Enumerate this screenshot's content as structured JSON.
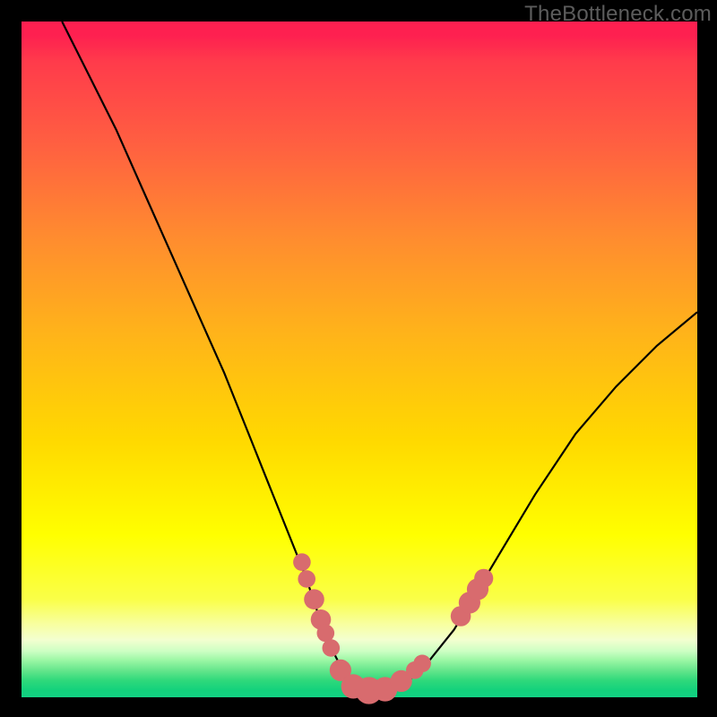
{
  "watermark": "TheBottleneck.com",
  "chart_data": {
    "type": "line",
    "title": "",
    "xlabel": "",
    "ylabel": "",
    "xlim": [
      0,
      100
    ],
    "ylim": [
      0,
      100
    ],
    "series": [
      {
        "name": "curve",
        "x": [
          6,
          10,
          14,
          18,
          22,
          26,
          30,
          34,
          36,
          38,
          40,
          42,
          44,
          45,
          46,
          47,
          48,
          49,
          50,
          51,
          52,
          53,
          54,
          56,
          58,
          60,
          64,
          70,
          76,
          82,
          88,
          94,
          100
        ],
        "y": [
          100,
          92,
          84,
          75,
          66,
          57,
          48,
          38,
          33,
          28,
          23,
          18,
          12,
          9,
          7,
          5,
          3,
          2,
          1,
          1,
          1,
          1,
          1,
          2,
          3,
          5,
          10,
          20,
          30,
          39,
          46,
          52,
          57
        ]
      }
    ],
    "markers": [
      {
        "x": 41.5,
        "y": 20,
        "r": 1.3
      },
      {
        "x": 42.2,
        "y": 17.5,
        "r": 1.3
      },
      {
        "x": 43.3,
        "y": 14.5,
        "r": 1.5
      },
      {
        "x": 44.3,
        "y": 11.5,
        "r": 1.5
      },
      {
        "x": 45.0,
        "y": 9.5,
        "r": 1.3
      },
      {
        "x": 45.8,
        "y": 7.3,
        "r": 1.3
      },
      {
        "x": 47.2,
        "y": 4.0,
        "r": 1.6
      },
      {
        "x": 49.1,
        "y": 1.6,
        "r": 1.8
      },
      {
        "x": 51.4,
        "y": 1.0,
        "r": 2.0
      },
      {
        "x": 53.8,
        "y": 1.2,
        "r": 1.8
      },
      {
        "x": 56.2,
        "y": 2.4,
        "r": 1.6
      },
      {
        "x": 58.2,
        "y": 4.0,
        "r": 1.3
      },
      {
        "x": 59.3,
        "y": 5.0,
        "r": 1.3
      },
      {
        "x": 65.0,
        "y": 12.0,
        "r": 1.5
      },
      {
        "x": 66.3,
        "y": 14.0,
        "r": 1.6
      },
      {
        "x": 67.5,
        "y": 16.0,
        "r": 1.6
      },
      {
        "x": 68.4,
        "y": 17.6,
        "r": 1.4
      }
    ],
    "colors": {
      "curve": "#000000",
      "marker": "#d86b6e"
    }
  }
}
